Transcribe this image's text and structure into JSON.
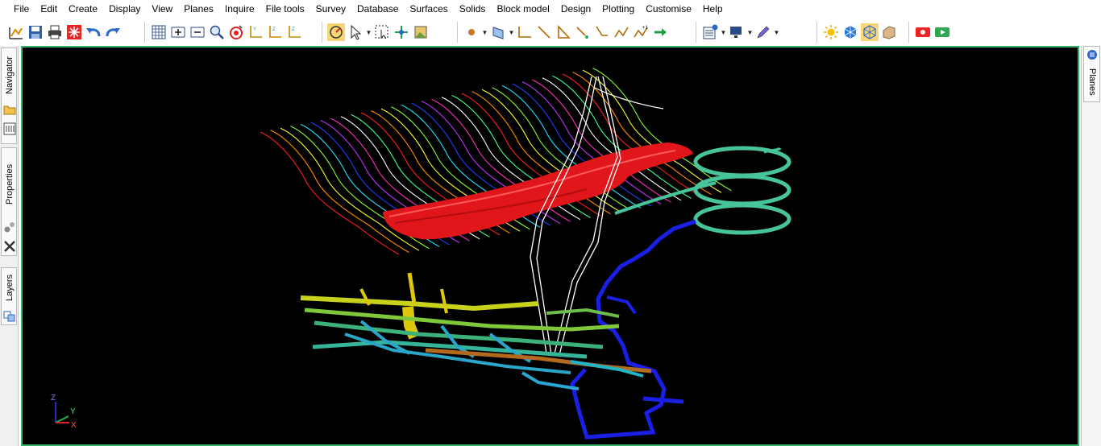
{
  "menu": [
    "File",
    "Edit",
    "Create",
    "Display",
    "View",
    "Planes",
    "Inquire",
    "File tools",
    "Survey",
    "Database",
    "Surfaces",
    "Solids",
    "Block model",
    "Design",
    "Plotting",
    "Customise",
    "Help"
  ],
  "left_tabs": {
    "navigator": "Navigator",
    "properties": "Properties",
    "layers": "Layers"
  },
  "right_tabs": {
    "planes": "Planes"
  },
  "axes": {
    "z": "Z",
    "y": "Y",
    "x": "X"
  },
  "colors": {
    "viewport_border": "#38b56b",
    "viewport_bg": "#000000"
  }
}
